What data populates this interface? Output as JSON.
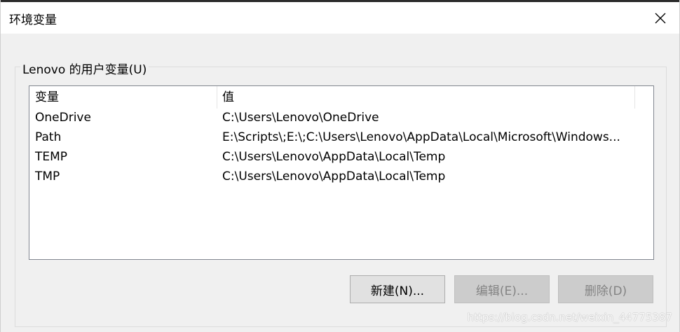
{
  "window": {
    "title": "环境变量"
  },
  "user_vars": {
    "group_label": "Lenovo 的用户变量(U)",
    "columns": [
      "变量",
      "值"
    ],
    "rows": [
      {
        "name": "OneDrive",
        "value": "C:\\Users\\Lenovo\\OneDrive"
      },
      {
        "name": "Path",
        "value": "E:\\Scripts\\;E:\\;C:\\Users\\Lenovo\\AppData\\Local\\Microsoft\\Windows..."
      },
      {
        "name": "TEMP",
        "value": "C:\\Users\\Lenovo\\AppData\\Local\\Temp"
      },
      {
        "name": "TMP",
        "value": "C:\\Users\\Lenovo\\AppData\\Local\\Temp"
      }
    ]
  },
  "buttons": {
    "new_label": "新建(N)...",
    "edit_label": "编辑(E)...",
    "delete_label": "删除(D)"
  },
  "watermark": "https://blog.csdn.net/weixin_44775387",
  "icons": {
    "close": "close-icon"
  },
  "colors": {
    "dialog_bg": "#f0f0f0",
    "titlebar_bg": "#ffffff",
    "button_bg": "#e1e1e1",
    "disabled_button_bg": "#cccccc",
    "disabled_text": "#838383"
  }
}
